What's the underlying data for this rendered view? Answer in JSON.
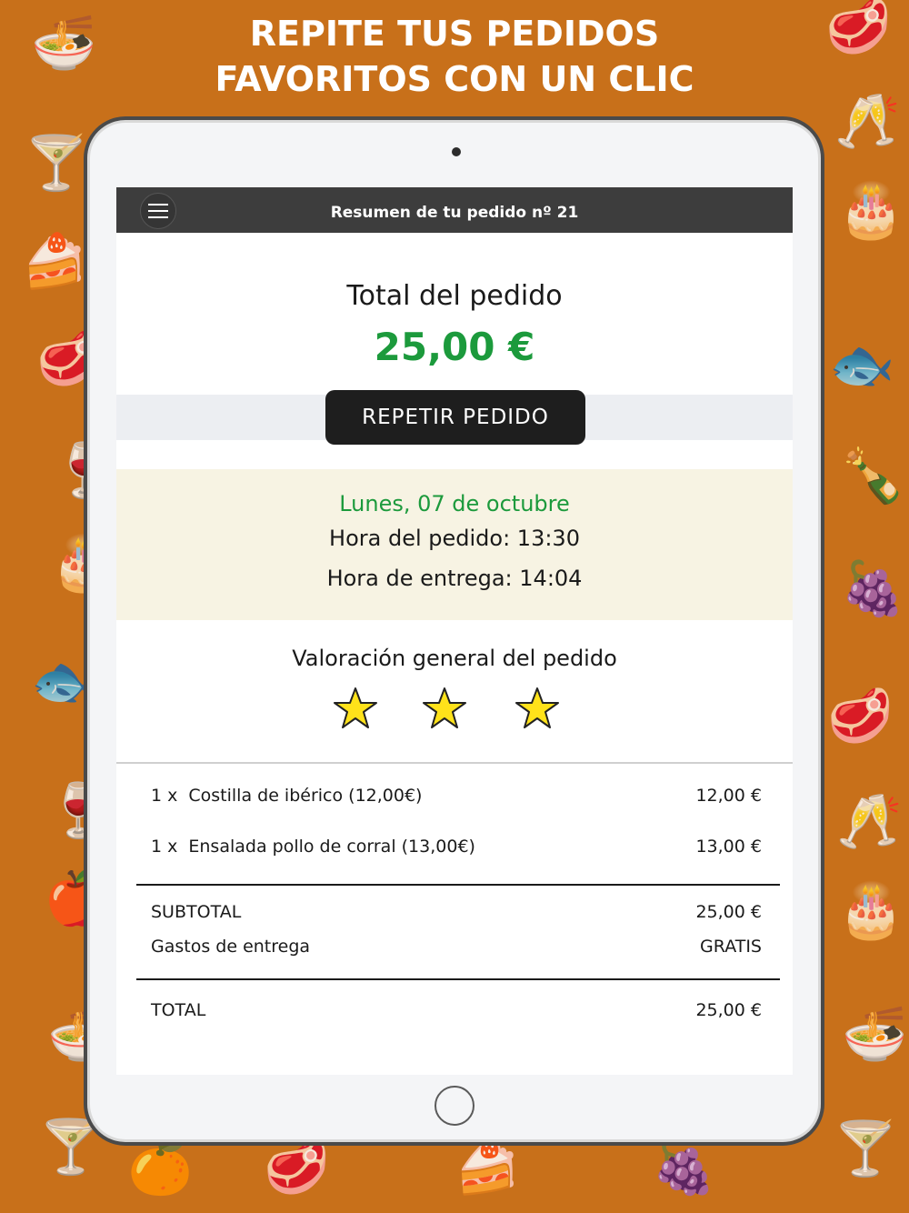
{
  "headline": {
    "line1": "REPITE TUS PEDIDOS",
    "line2": "FAVORITOS CON UN CLIC"
  },
  "colors": {
    "background": "#c8701a",
    "accent_green": "#1c9a3c",
    "topbar": "#3d3d3d",
    "star_fill": "#ffe21a"
  },
  "header": {
    "menu_icon": "hamburger-menu-icon",
    "title": "Resumen de tu pedido nº 21"
  },
  "total": {
    "label": "Total del pedido",
    "value": "25,00 €"
  },
  "repeat_button": {
    "label": "REPETIR PEDIDO"
  },
  "schedule": {
    "date": "Lunes, 07 de octubre",
    "order_time": "Hora del pedido: 13:30",
    "delivery_time": "Hora de entrega: 14:04"
  },
  "rating": {
    "label": "Valoración general del pedido",
    "stars": 3,
    "star_icon": "star-icon"
  },
  "items": [
    {
      "qty": "1 x",
      "name": "Costilla de ibérico (12,00€)",
      "price": "12,00 €"
    },
    {
      "qty": "1 x",
      "name": "Ensalada pollo de corral (13,00€)",
      "price": "13,00 €"
    }
  ],
  "summary": {
    "subtotal_label": "SUBTOTAL",
    "subtotal_value": "25,00 €",
    "delivery_label": "Gastos de entrega",
    "delivery_value": "GRATIS",
    "total_label": "TOTAL",
    "total_value": "25,00 €"
  }
}
